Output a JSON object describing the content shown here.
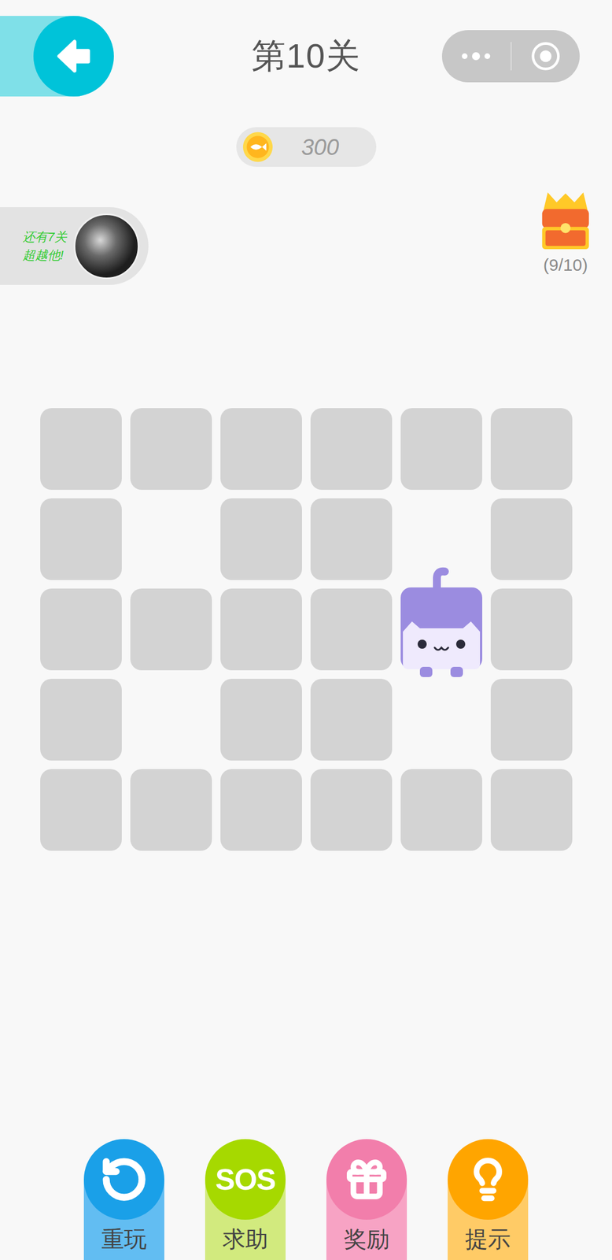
{
  "header": {
    "title": "第10关"
  },
  "coins": {
    "amount": "300"
  },
  "challenge": {
    "lines": [
      "还有7关",
      "超越他!"
    ]
  },
  "chest": {
    "progress": "(9/10)"
  },
  "board": {
    "rows": [
      {
        "cells": [
          {
            "kind": "tile"
          },
          {
            "kind": "tile"
          },
          {
            "kind": "tile"
          },
          {
            "kind": "tile"
          },
          {
            "kind": "tile"
          },
          {
            "kind": "tile"
          }
        ]
      },
      {
        "cells": [
          {
            "kind": "tile"
          },
          {
            "kind": "empty"
          },
          {
            "kind": "tile"
          },
          {
            "kind": "tile"
          },
          {
            "kind": "empty"
          },
          {
            "kind": "tile"
          }
        ]
      },
      {
        "cells": [
          {
            "kind": "tile"
          },
          {
            "kind": "tile"
          },
          {
            "kind": "tile"
          },
          {
            "kind": "tile"
          },
          {
            "kind": "cat"
          },
          {
            "kind": "tile"
          }
        ]
      },
      {
        "cells": [
          {
            "kind": "tile"
          },
          {
            "kind": "empty"
          },
          {
            "kind": "tile"
          },
          {
            "kind": "tile"
          },
          {
            "kind": "empty"
          },
          {
            "kind": "tile"
          }
        ]
      },
      {
        "cells": [
          {
            "kind": "tile"
          },
          {
            "kind": "tile"
          },
          {
            "kind": "tile"
          },
          {
            "kind": "tile"
          },
          {
            "kind": "tile"
          },
          {
            "kind": "tile"
          }
        ]
      }
    ]
  },
  "buttons": [
    {
      "label": "重玩",
      "kind": "replay",
      "color": "#1aa0e8",
      "icon_text": ""
    },
    {
      "label": "求助",
      "kind": "sos",
      "color": "#a6d900",
      "icon_text": "SOS"
    },
    {
      "label": "奖励",
      "kind": "reward",
      "color": "#f27eab",
      "icon_text": ""
    },
    {
      "label": "提示",
      "kind": "hint",
      "color": "#ffa500",
      "icon_text": ""
    }
  ]
}
